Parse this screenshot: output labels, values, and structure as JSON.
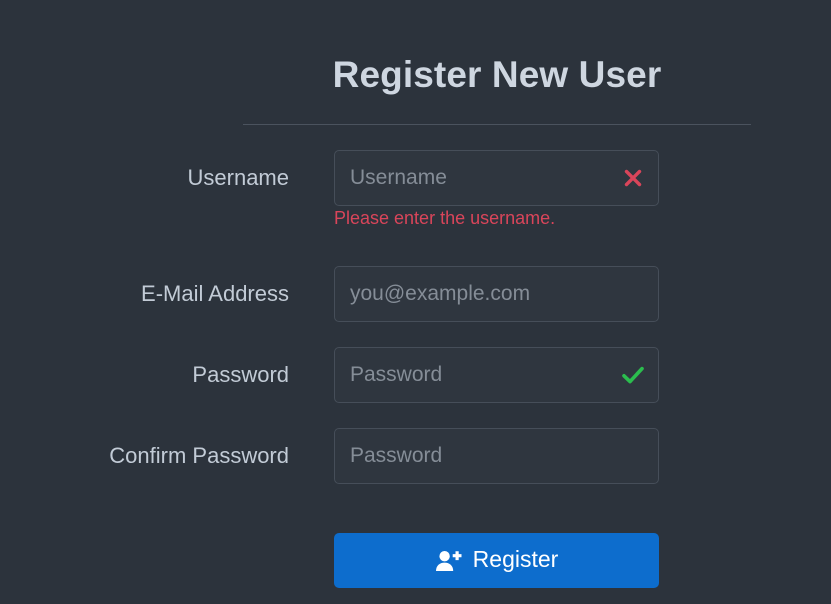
{
  "form": {
    "title": "Register New User",
    "fields": [
      {
        "label": "Username",
        "placeholder": "Username",
        "value": "",
        "validation": "invalid",
        "validation_icon": "cross-icon",
        "error": "Please enter the username."
      },
      {
        "label": "E-Mail Address",
        "placeholder": "you@example.com",
        "value": "",
        "validation": "none",
        "validation_icon": "",
        "error": ""
      },
      {
        "label": "Password",
        "placeholder": "Password",
        "value": "",
        "validation": "valid",
        "validation_icon": "check-icon",
        "error": ""
      },
      {
        "label": "Confirm Password",
        "placeholder": "Password",
        "value": "",
        "validation": "none",
        "validation_icon": "",
        "error": ""
      }
    ],
    "submit": {
      "label": "Register",
      "icon": "user-plus-icon"
    }
  },
  "colors": {
    "background": "#2c333c",
    "title_text": "#ced6e0",
    "divider": "#4b535e",
    "label_text": "#c2cbd6",
    "input_background": "#2f363f",
    "input_border": "#464e59",
    "placeholder_text": "#858d97",
    "error_text": "#d9455a",
    "invalid_icon": "#d9455a",
    "valid_icon": "#2bbd4e",
    "button_background": "#0d6dcd",
    "button_text": "#ffffff"
  }
}
